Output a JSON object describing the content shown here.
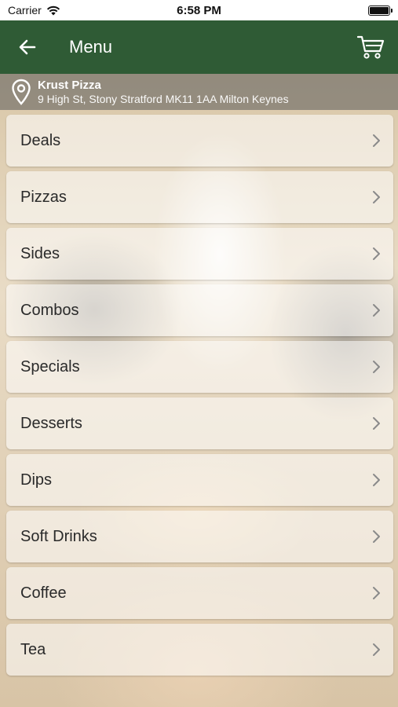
{
  "status_bar": {
    "carrier": "Carrier",
    "time": "6:58 PM"
  },
  "nav": {
    "title": "Menu",
    "back_icon": "arrow-left-icon",
    "cart_icon": "cart-icon",
    "bar_color": "#2f5b35"
  },
  "location": {
    "name": "Krust Pizza",
    "address": "9 High St, Stony Stratford MK11 1AA Milton Keynes",
    "icon": "location-pin-icon"
  },
  "menu": {
    "items": [
      {
        "label": "Deals"
      },
      {
        "label": "Pizzas"
      },
      {
        "label": "Sides"
      },
      {
        "label": "Combos"
      },
      {
        "label": "Specials"
      },
      {
        "label": "Desserts"
      },
      {
        "label": "Dips"
      },
      {
        "label": "Soft Drinks"
      },
      {
        "label": "Coffee"
      },
      {
        "label": "Tea"
      }
    ]
  }
}
